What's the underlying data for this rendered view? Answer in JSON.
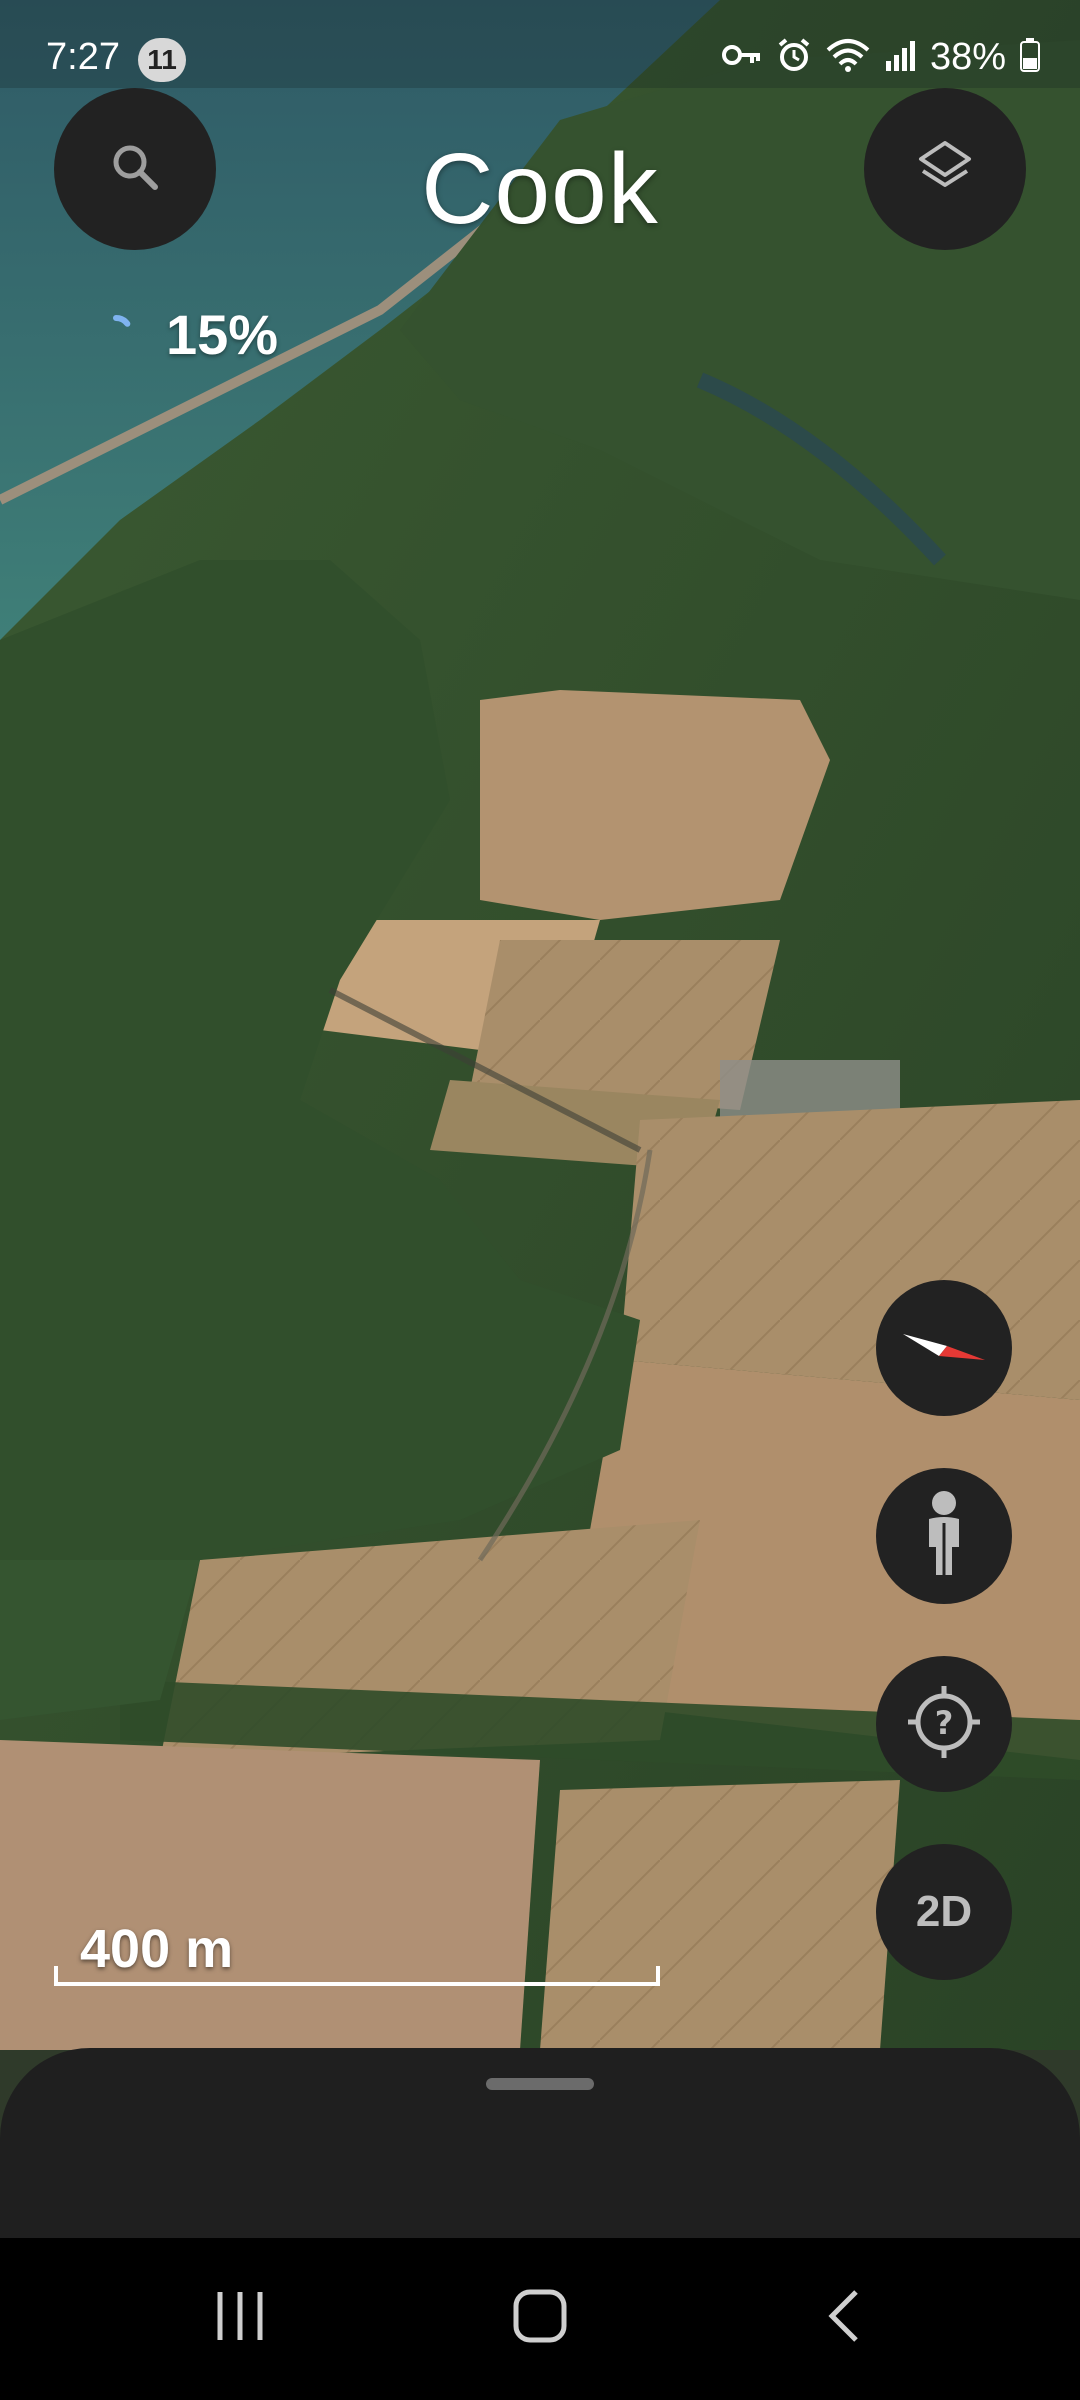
{
  "status_bar": {
    "time": "7:27",
    "notification_count": "11",
    "battery_percent": "38%",
    "icons": [
      "vpn-key-icon",
      "alarm-icon",
      "wifi-icon",
      "signal-icon",
      "battery-icon"
    ]
  },
  "map": {
    "place_title": "Cook",
    "loading_percent": "15%",
    "loading_progress": 0.15,
    "scale_label": "400 m"
  },
  "controls": {
    "search_icon": "search-icon",
    "layers_icon": "layers-icon",
    "compass_icon": "compass-icon",
    "street_view_icon": "pegman-icon",
    "my_location_icon": "my-location-icon",
    "toggle_2d_label": "2D"
  },
  "colors": {
    "button_bg": "#222222",
    "sheet_bg": "#1f1f1f",
    "compass_red": "#e53935"
  }
}
